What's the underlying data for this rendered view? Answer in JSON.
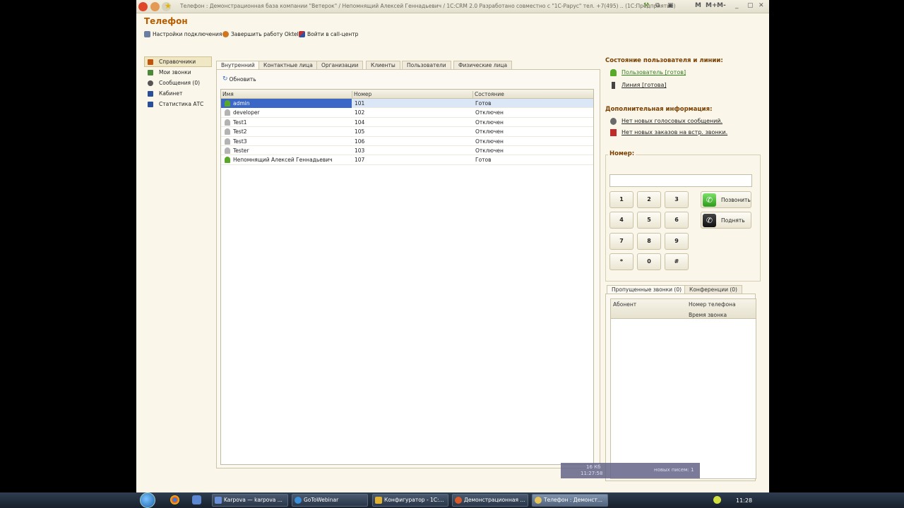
{
  "window": {
    "title": "Телефон : Демонстрационная база компании \"Ветерок\" / Непомнящий Алексей Геннадьевич / 1С:CRM 2.0  Разработано совместно с \"1С-Рарус\" тел. +7(495)  .. (1С:Предприятие)",
    "right_buttons": [
      "M",
      "M+",
      "M-"
    ]
  },
  "page": {
    "title": "Телефон"
  },
  "toolbar": {
    "settings": "Настройки подключения",
    "finish": "Завершить работу Oktell",
    "callcenter": "Войти в call-центр"
  },
  "sidebar": {
    "items": [
      {
        "label": "Справочники",
        "color": "#c0560e"
      },
      {
        "label": "Мои звонки",
        "color": "#4a8a3a"
      },
      {
        "label": "Сообщения (0)",
        "color": "#555555"
      },
      {
        "label": "Кабинет",
        "color": "#2a4f9a"
      },
      {
        "label": "Статистика АТС",
        "color": "#2a4f9a"
      }
    ]
  },
  "tabs": [
    "Внутренний",
    "Контактные лица",
    "Организации",
    "Клиенты",
    "Пользователи",
    "Физические лица"
  ],
  "main": {
    "refresh": "Обновить",
    "columns": [
      "Имя",
      "Номер",
      "Состояние"
    ],
    "rows": [
      {
        "name": "admin",
        "number": "101",
        "status": "Готов",
        "online": true
      },
      {
        "name": "developer",
        "number": "102",
        "status": "Отключен",
        "online": false
      },
      {
        "name": "Test1",
        "number": "104",
        "status": "Отключен",
        "online": false
      },
      {
        "name": "Test2",
        "number": "105",
        "status": "Отключен",
        "online": false
      },
      {
        "name": "Test3",
        "number": "106",
        "status": "Отключен",
        "online": false
      },
      {
        "name": "Tester",
        "number": "103",
        "status": "Отключен",
        "online": false
      },
      {
        "name": "Непомнящий Алексей Геннадьевич",
        "number": "107",
        "status": "Готов",
        "online": true
      }
    ]
  },
  "right": {
    "state_heading": "Состояние пользователя и линии:",
    "user_link": "Пользователь [готов]",
    "line_link": "Линия [готова]",
    "info_heading": "Дополнительная информация:",
    "voice_link": "Нет новых голосовых сообщений.",
    "orders_link": "Нет новых заказов на встр. звонки.",
    "number_label": "Номер:",
    "keys": [
      "1",
      "2",
      "3",
      "4",
      "5",
      "6",
      "7",
      "8",
      "9",
      "*",
      "0",
      "#"
    ],
    "call_label": "Позвонить",
    "pickup_label": "Поднять",
    "lower_tabs": [
      "Пропущенные звонки (0)",
      "Конференции (0)"
    ],
    "lower_columns": {
      "subscriber": "Абонент",
      "phone": "Номер телефона",
      "time": "Время звонка"
    }
  },
  "notification": {
    "size": "16 Кб",
    "time": "11:27:58",
    "text": "новых писем: 1"
  },
  "taskbar": {
    "tasks": [
      "Karpova — karpova ...",
      "GoToWebinar",
      "Конфигуратор - 1С:...",
      "Демонстрационная ...",
      "Телефон : Демонст..."
    ],
    "clock": "11:28"
  }
}
